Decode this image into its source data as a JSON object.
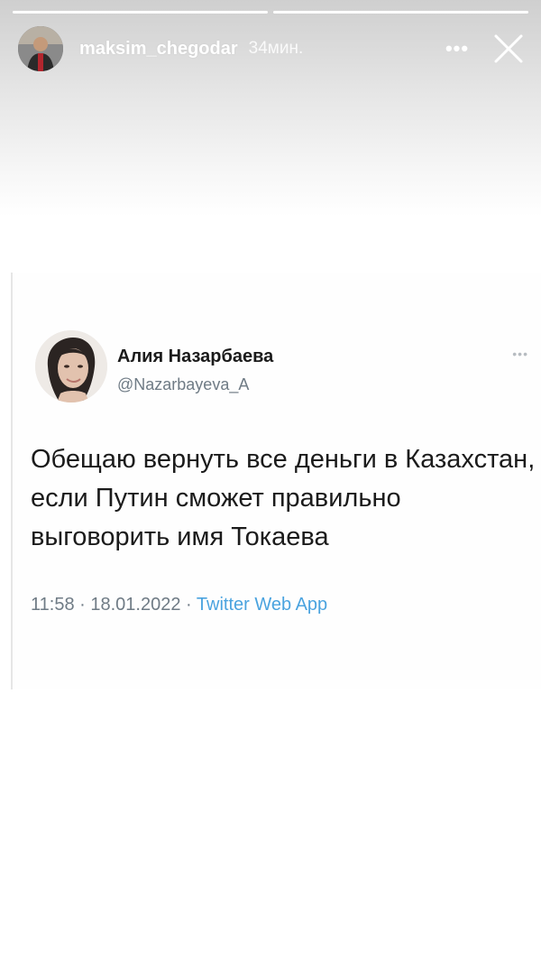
{
  "story": {
    "progress": [
      1,
      1
    ],
    "username": "maksim_chegodar",
    "time": "34мин.",
    "more_icon": "more-horizontal-icon",
    "close_icon": "close-icon"
  },
  "tweet": {
    "name": "Алия Назарбаева",
    "handle": "@Nazarbayeva_A",
    "text": "Обещаю вернуть все деньги в Казахстан, если Путин сможет правильно выговорить имя Токаева",
    "time": "11:58",
    "date": "18.01.2022",
    "separator": "·",
    "source": "Twitter Web App",
    "more_icon": "more-dots-icon"
  },
  "colors": {
    "link": "#4aa3df",
    "secondary_text": "#6f7b85",
    "primary_text": "#1b1b1b"
  }
}
